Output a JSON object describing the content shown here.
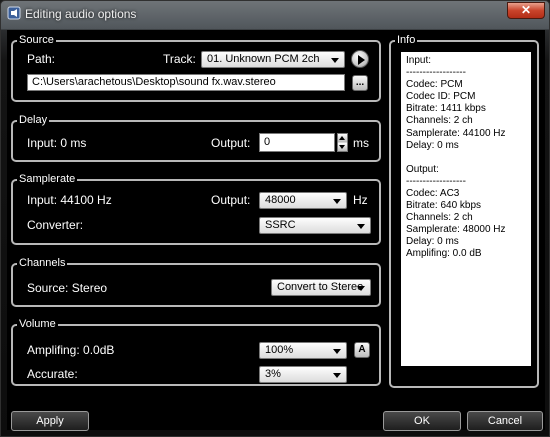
{
  "window": {
    "title": "Editing audio options"
  },
  "source": {
    "legend": "Source",
    "path_label": "Path:",
    "track_label": "Track:",
    "track_value": "01. Unknown PCM 2ch",
    "path_value": "C:\\Users\\arachetous\\Desktop\\sound fx.wav.stereo",
    "browse_label": "..."
  },
  "delay": {
    "legend": "Delay",
    "input_label": "Input: 0 ms",
    "output_label": "Output:",
    "output_value": "0",
    "unit": "ms"
  },
  "samplerate": {
    "legend": "Samplerate",
    "input_label": "Input: 44100 Hz",
    "output_label": "Output:",
    "output_value": "48000",
    "unit": "Hz",
    "converter_label": "Converter:",
    "converter_value": "SSRC"
  },
  "channels": {
    "legend": "Channels",
    "source_label": "Source: Stereo",
    "convert_value": "Convert to Stereo"
  },
  "volume": {
    "legend": "Volume",
    "amplifing_label": "Amplifing: 0.0dB",
    "amplifing_value": "100%",
    "auto_label": "A",
    "accurate_label": "Accurate:",
    "accurate_value": "3%"
  },
  "info": {
    "legend": "Info",
    "lines": [
      "Input:",
      "------------------",
      "Codec: PCM",
      "Codec ID: PCM",
      "Bitrate: 1411 kbps",
      "Channels: 2 ch",
      "Samplerate: 44100 Hz",
      "Delay: 0 ms",
      "",
      "Output:",
      "------------------",
      "Codec: AC3",
      "Bitrate: 640 kbps",
      "Channels: 2 ch",
      "Samplerate: 48000 Hz",
      "Delay: 0 ms",
      "Amplifing: 0.0 dB"
    ]
  },
  "buttons": {
    "apply": "Apply",
    "ok": "OK",
    "cancel": "Cancel"
  },
  "colors": {
    "group_border": "#b8b8b8",
    "close_button": "#c9442b"
  }
}
